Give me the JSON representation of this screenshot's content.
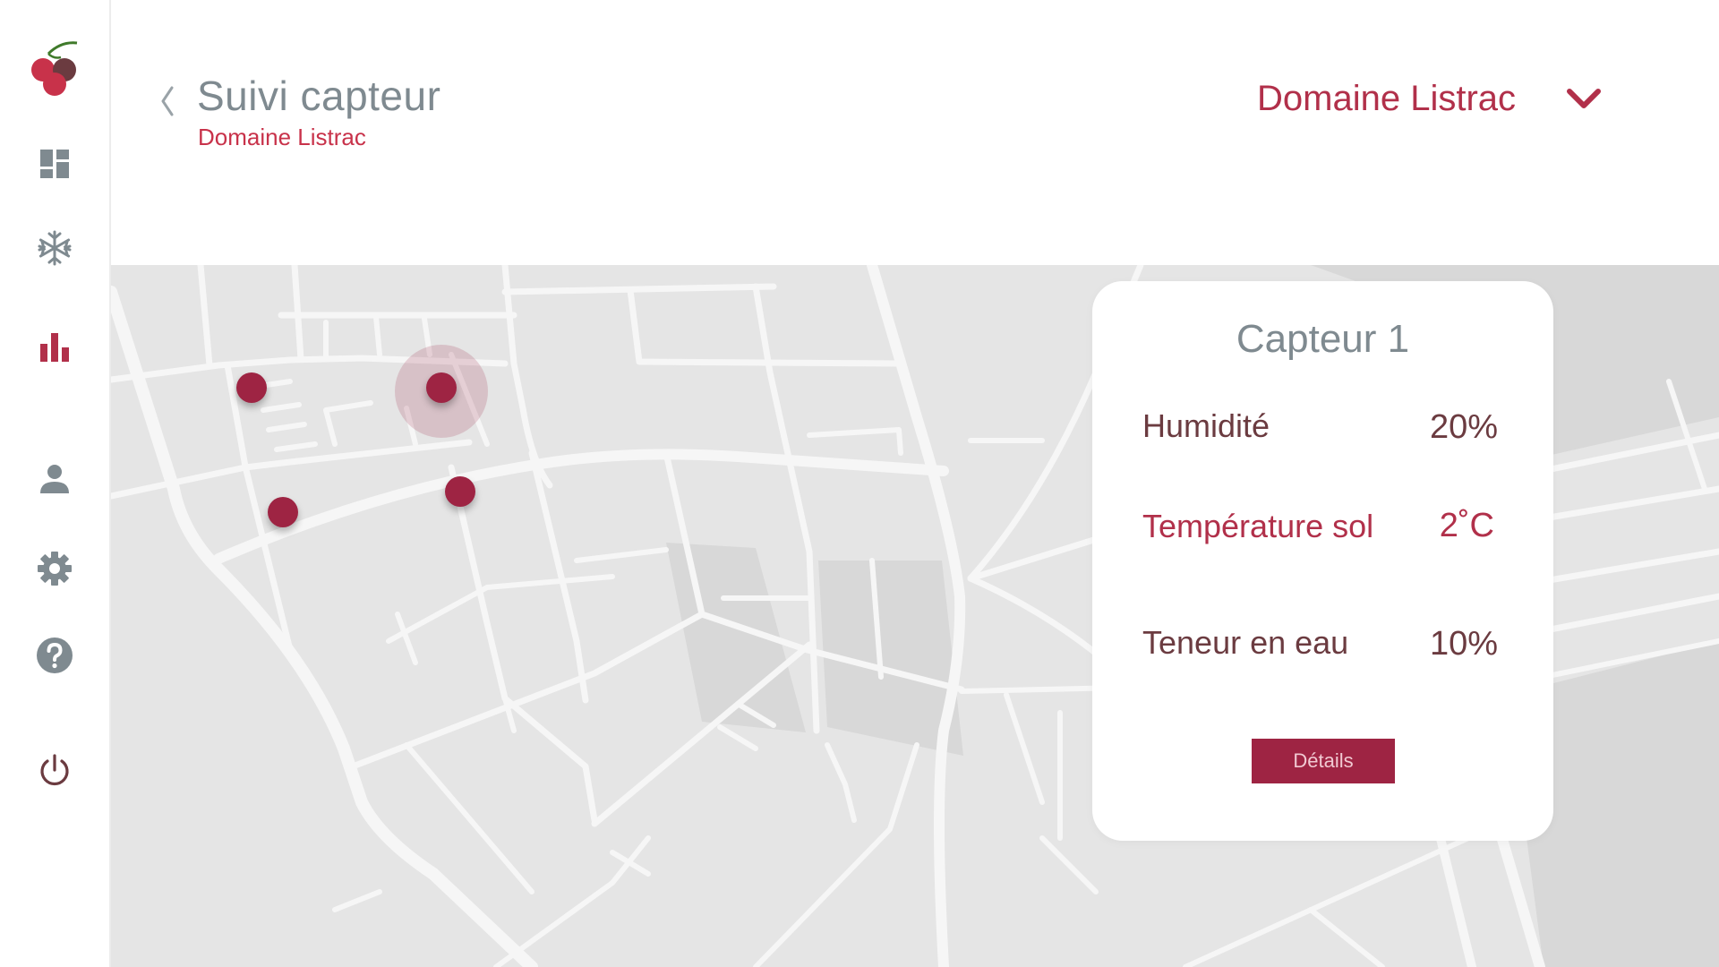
{
  "header": {
    "title": "Suivi capteur",
    "subtitle": "Domaine Listrac",
    "domain_selector": {
      "selected": "Domaine Listrac"
    }
  },
  "sidebar": {
    "items": [
      {
        "icon": "dashboard-icon"
      },
      {
        "icon": "snowflake-icon"
      },
      {
        "icon": "bar-chart-icon",
        "active": true
      },
      {
        "icon": "user-icon"
      },
      {
        "icon": "gear-icon"
      },
      {
        "icon": "help-icon"
      },
      {
        "icon": "power-icon"
      }
    ]
  },
  "sensor_card": {
    "title": "Capteur 1",
    "metrics": [
      {
        "label": "Humidité",
        "value": "20%"
      },
      {
        "label": "Température sol",
        "value": "2˚C"
      },
      {
        "label": "Teneur en eau",
        "value": "10%"
      }
    ],
    "details_button": "Détails"
  },
  "colors": {
    "accent": "#9e2443",
    "accent_light": "#c8324a",
    "title_gray": "#7f8a90",
    "text_dark": "#6b3b40",
    "map_bg": "#e5e5e5",
    "map_block": "#d8d8d8",
    "street": "#f5f5f5"
  }
}
